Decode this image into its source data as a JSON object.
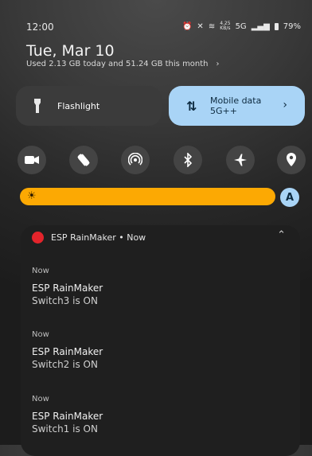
{
  "status_bar": {
    "time": "12:00",
    "alarm_icon": "alarm-icon",
    "mute_icon": "vibrate-off-icon",
    "wifi_icon": "wifi-icon",
    "net_speed_value": "4.25",
    "net_speed_unit": "KB/s",
    "network": "5G",
    "battery": "79%"
  },
  "header": {
    "date": "Tue, Mar 10",
    "usage": "Used 2.13 GB today and 51.24 GB this month"
  },
  "tiles": {
    "flashlight": {
      "label": "Flashlight",
      "icon": "flashlight-icon"
    },
    "mobile_data": {
      "label": "Mobile data",
      "sublabel": "5G++",
      "icon": "mobile-data-icon",
      "chevron": "chevron-right-icon"
    }
  },
  "quick_toggles": [
    {
      "name": "camera-icon"
    },
    {
      "name": "auto-rotate-icon"
    },
    {
      "name": "hotspot-icon"
    },
    {
      "name": "bluetooth-icon"
    },
    {
      "name": "airplane-icon"
    },
    {
      "name": "location-icon"
    }
  ],
  "brightness": {
    "level": 0.98,
    "icon": "sun-icon"
  },
  "auto_brightness": {
    "label": "A"
  },
  "notification_group": {
    "app": "ESP RainMaker • Now",
    "items": [
      {
        "time": "Now",
        "title": "ESP RainMaker",
        "body": "Switch3 is ON"
      },
      {
        "time": "Now",
        "title": "ESP RainMaker",
        "body": "Switch2 is ON"
      },
      {
        "time": "Now",
        "title": "ESP RainMaker",
        "body": "Switch1 is ON"
      }
    ]
  },
  "colors": {
    "accent_blue": "#a9d4f6",
    "brightness_orange": "#fca903",
    "app_red": "#e3242b"
  }
}
